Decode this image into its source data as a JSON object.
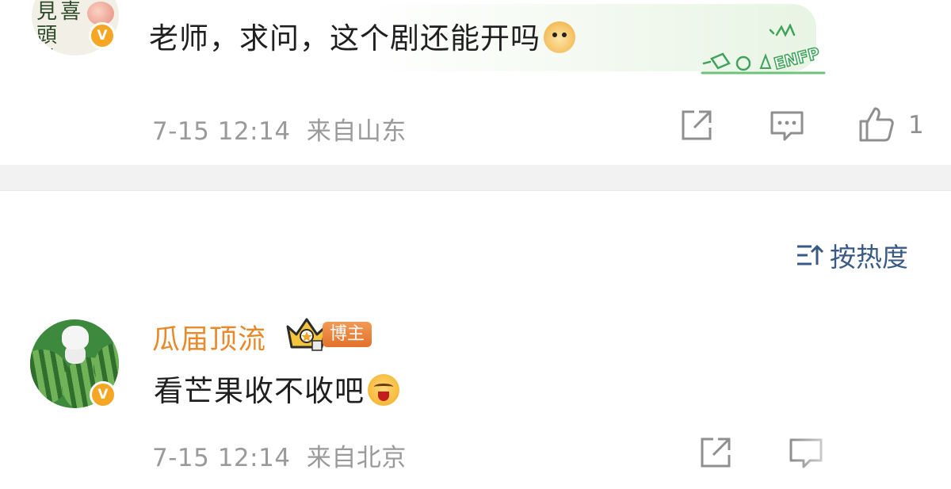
{
  "comment1": {
    "avatar_calligraphy": "见喜\n頭\n徹",
    "verified_badge": "V",
    "text": "老师，求问，这个剧还能开吗",
    "emoji": "doge-emoji",
    "decor_label": "ENFP",
    "timestamp": "7-15 12:14",
    "location": "来自山东",
    "like_count": "1"
  },
  "sort": {
    "label": "按热度"
  },
  "comment2": {
    "username": "瓜届顶流",
    "user_badge": "博主",
    "verified_badge": "V",
    "text": "看芒果收不收吧",
    "emoji": "tongue-out-emoji",
    "timestamp": "7-15 12:14",
    "location": "来自北京"
  },
  "colors": {
    "username": "#e8892b",
    "sort_link": "#3a5a86",
    "meta": "#9a9a9a",
    "badge": "#e2712a",
    "verified": "#f5a623"
  }
}
